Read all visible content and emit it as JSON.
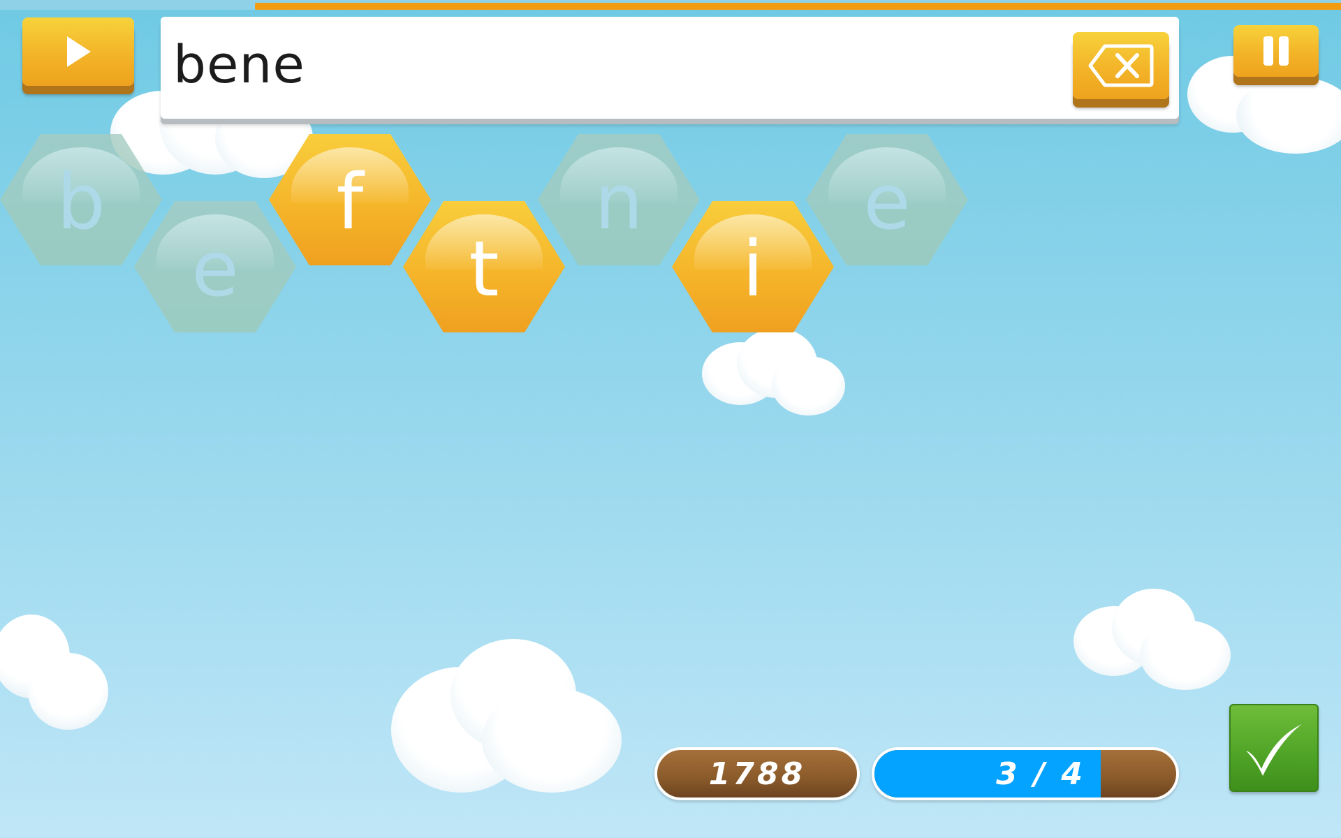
{
  "game": {
    "current_word": "bene",
    "timer_remaining": 0.81,
    "score": "1788",
    "progress": {
      "label": "3 / 4",
      "fraction": 0.75
    }
  },
  "tiles": [
    {
      "letter": "b",
      "state": "used"
    },
    {
      "letter": "e",
      "state": "used"
    },
    {
      "letter": "f",
      "state": "active"
    },
    {
      "letter": "t",
      "state": "active"
    },
    {
      "letter": "n",
      "state": "used"
    },
    {
      "letter": "i",
      "state": "active"
    },
    {
      "letter": "e",
      "state": "used"
    }
  ],
  "icons": {
    "play": "play-icon",
    "pause": "pause-icon",
    "backspace": "backspace-icon",
    "check": "checkmark-icon"
  },
  "colors": {
    "accent_orange": "#f3b428",
    "progress_blue": "#03a3ff",
    "confirm_green": "#4ea326"
  }
}
